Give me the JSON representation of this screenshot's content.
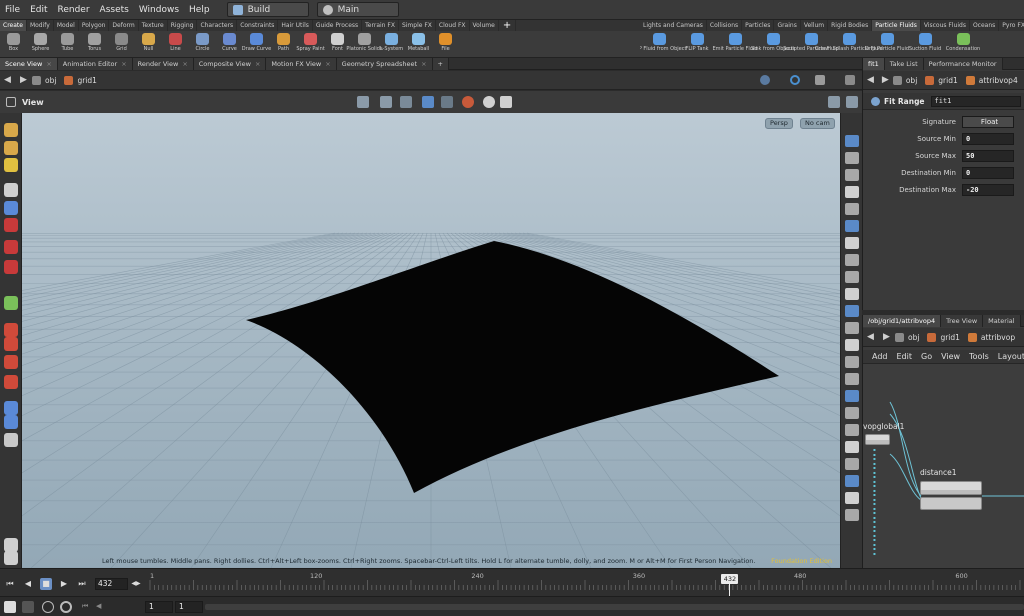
{
  "menubar": {
    "items": [
      "File",
      "Edit",
      "Render",
      "Assets",
      "Windows",
      "Help"
    ],
    "desktop": "Build",
    "context": "Main"
  },
  "shelf_tabs_left": [
    "Create",
    "Modify",
    "Model",
    "Polygon",
    "Deform",
    "Texture",
    "Rigging",
    "Characters",
    "Constraints",
    "Hair Utils",
    "Guide Process",
    "Terrain FX",
    "Simple FX",
    "Cloud FX",
    "Volume"
  ],
  "shelf_tabs_right": [
    "Lights and Cameras",
    "Collisions",
    "Particles",
    "Grains",
    "Vellum",
    "Rigid Bodies",
    "Particle Fluids",
    "Viscous Fluids",
    "Oceans",
    "Pyro FX"
  ],
  "shelf_tabs_right_active": "Particle Fluids",
  "shelf_tools_left": [
    {
      "label": "Box",
      "icon": "box-icon",
      "color": "#9a9a9a"
    },
    {
      "label": "Sphere",
      "icon": "sphere-icon",
      "color": "#a8a8a8"
    },
    {
      "label": "Tube",
      "icon": "tube-icon",
      "color": "#9a9a9a"
    },
    {
      "label": "Torus",
      "icon": "torus-icon",
      "color": "#a0a0a0"
    },
    {
      "label": "Grid",
      "icon": "grid-icon",
      "color": "#8a8a8a"
    },
    {
      "label": "Null",
      "icon": "null-icon",
      "color": "#d8a84a"
    },
    {
      "label": "Line",
      "icon": "line-icon",
      "color": "#c84a4a"
    },
    {
      "label": "Circle",
      "icon": "circle-icon",
      "color": "#7a9ac8"
    },
    {
      "label": "Curve",
      "icon": "curve-icon",
      "color": "#6a8ad0"
    },
    {
      "label": "Draw Curve",
      "icon": "draw-curve-icon",
      "color": "#5a8ad8"
    },
    {
      "label": "Path",
      "icon": "path-icon",
      "color": "#d89a3a"
    },
    {
      "label": "Spray Paint",
      "icon": "spray-paint-icon",
      "color": "#d85a5a"
    },
    {
      "label": "Font",
      "icon": "font-icon",
      "color": "#d0d0d0"
    },
    {
      "label": "Platonic Solids",
      "icon": "platonic-solids-icon",
      "color": "#a0a0a0"
    },
    {
      "label": "L-System",
      "icon": "l-system-icon",
      "color": "#7ab0e0"
    },
    {
      "label": "Metaball",
      "icon": "metaball-icon",
      "color": "#8ac0e8"
    },
    {
      "label": "File",
      "icon": "file-icon",
      "color": "#e0902a"
    }
  ],
  "shelf_tools_right": [
    {
      "label": "FLIP Fluid from Object",
      "icon": "flip-fluid-icon",
      "color": "#5a9ae0"
    },
    {
      "label": "FLIP Tank",
      "icon": "flip-tank-icon",
      "color": "#5a9ae0"
    },
    {
      "label": "Emit Particle Fluid",
      "icon": "emit-fluid-icon",
      "color": "#5a9ae0"
    },
    {
      "label": "Sink from Objects",
      "icon": "sink-icon",
      "color": "#5a9ae0"
    },
    {
      "label": "Sculpted Particle Fluid",
      "icon": "sculpted-fluid-icon",
      "color": "#5a9ae0"
    },
    {
      "label": "Crown Splash Particle Fluid",
      "icon": "crown-splash-icon",
      "color": "#5a9ae0"
    },
    {
      "label": "Drip Particle Fluid",
      "icon": "drip-fluid-icon",
      "color": "#5a9ae0"
    },
    {
      "label": "Suction Fluid",
      "icon": "suction-fluid-icon",
      "color": "#5a9ae0"
    },
    {
      "label": "Condensation",
      "icon": "condensation-icon",
      "color": "#7ac05a"
    }
  ],
  "pane_tabs_left": [
    "Scene View",
    "Animation Editor",
    "Render View",
    "Composite View",
    "Motion FX View",
    "Geometry Spreadsheet"
  ],
  "pane_tabs_right": [
    "fit1",
    "Take List",
    "Performance Monitor"
  ],
  "viewport_path": {
    "root": "obj",
    "node": "grid1"
  },
  "viewport": {
    "title": "View",
    "camera": "Persp",
    "cam_mode": "No cam",
    "status": "Left mouse tumbles. Middle pans. Right dollies. Ctrl+Alt+Left box-zooms. Ctrl+Right zooms. Spacebar-Ctrl-Left tilts. Hold L for alternate tumble, dolly, and zoom.    M or Alt+M for First Person Navigation.",
    "foundation": "Foundation Edition",
    "background_colors": [
      "#bccad4",
      "#93a8b6"
    ]
  },
  "param_path": {
    "root": "obj",
    "node": "grid1",
    "sub": "attribvop4"
  },
  "params": {
    "node_type": "Fit Range",
    "node_name": "fit1",
    "signature_label": "Signature",
    "signature_value": "Float",
    "rows": [
      {
        "label": "Source Min",
        "value": "0"
      },
      {
        "label": "Source Max",
        "value": "50"
      },
      {
        "label": "Destination Min",
        "value": "0"
      },
      {
        "label": "Destination Max",
        "value": "-20"
      }
    ]
  },
  "net_tabs": [
    "/obj/grid1/attribvop4",
    "Tree View",
    "Material"
  ],
  "net_path": {
    "root": "obj",
    "node": "grid1",
    "sub": "attribvop"
  },
  "net_menu": [
    "Add",
    "Edit",
    "Go",
    "View",
    "Tools",
    "Layout"
  ],
  "net_nodes": {
    "global": "vopglobal1",
    "distance": "distance1"
  },
  "timeline": {
    "current_frame": "432",
    "ticks": [
      "1",
      "120",
      "240",
      "360",
      "480",
      "600"
    ],
    "range_start": "1",
    "range_end": "1"
  }
}
